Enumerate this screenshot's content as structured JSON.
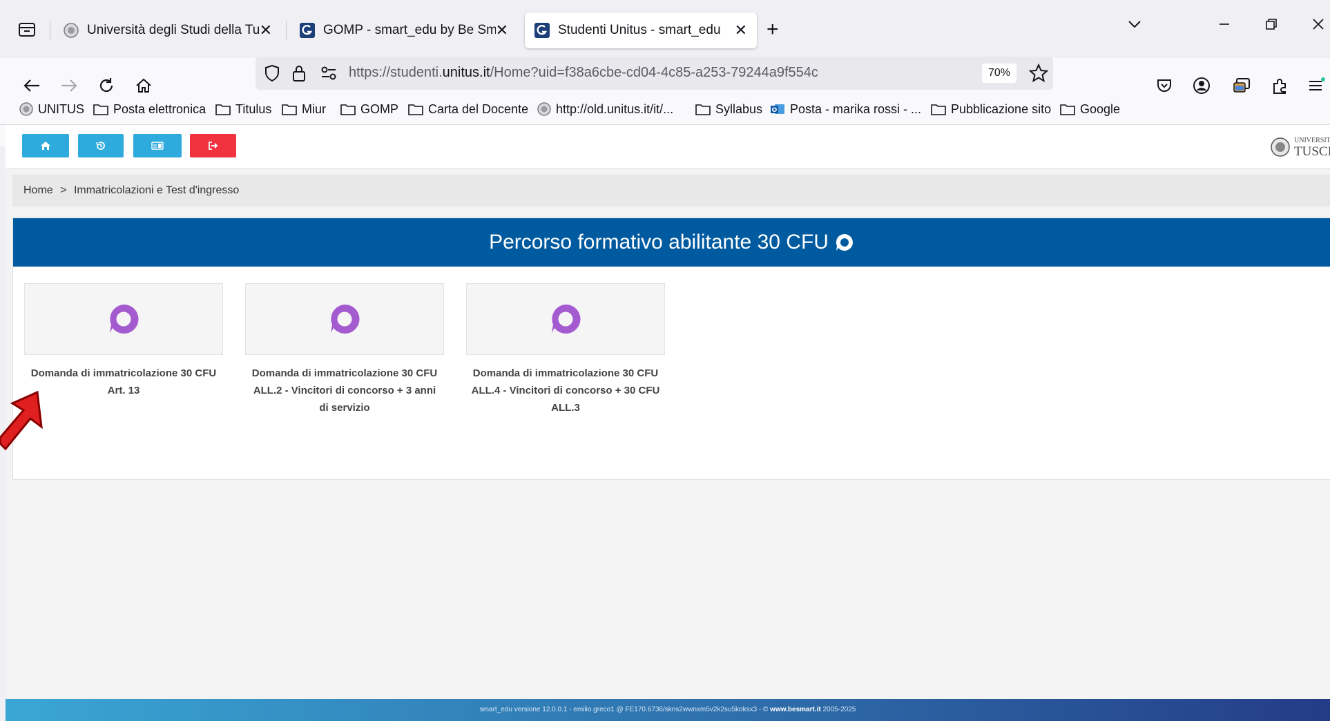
{
  "browser": {
    "tabs": [
      {
        "title": "Università degli Studi della Tuscia"
      },
      {
        "title": "GOMP - smart_edu by Be Smart - Gestione"
      },
      {
        "title": "Studenti Unitus - smart_edu"
      }
    ],
    "url": {
      "prefix": "https://studenti.",
      "domain": "unitus.it",
      "path": "/Home?uid=f38a6cbe-cd04-4c85-a253-79244a9f554c"
    },
    "zoom": "70%",
    "bookmarks": [
      "UNITUS",
      "Posta elettronica",
      "Titulus",
      "Miur",
      "GOMP",
      "Carta del Docente",
      "http://old.unitus.it/it/...",
      "Syllabus",
      "Posta - marika rossi - ...",
      "Pubblicazione sito",
      "Google"
    ]
  },
  "toolbar": {
    "colors": {
      "info": "#2eaadc",
      "danger": "#f0333f"
    },
    "logo_line1": "UNIVERSITÀ",
    "logo_line2": "TUSCIA"
  },
  "breadcrumb": {
    "home": "Home",
    "sep": ">",
    "current": "Immatricolazioni e Test d'ingresso"
  },
  "panel": {
    "title": "Percorso formativo abilitante 30 CFU",
    "header_color": "#005aa0",
    "cards": [
      {
        "label": "Domanda di immatricolazione 30 CFU Art. 13"
      },
      {
        "label": "Domanda di immatricolazione 30 CFU ALL.2 - Vincitori di concorso + 3 anni di servizio"
      },
      {
        "label": "Domanda di immatricolazione 30 CFU ALL.4 - Vincitori di concorso + 30 CFU ALL.3"
      }
    ],
    "icon_color": "#a55bd0"
  },
  "footer": {
    "text": "smart_edu versione 12.0.0.1 - emilio.greco1 @ FE170.6736/skns2wwnxm5v2k2su5koksx3 - © ",
    "link": "www.besmart.it",
    "years": " 2005-2025"
  }
}
